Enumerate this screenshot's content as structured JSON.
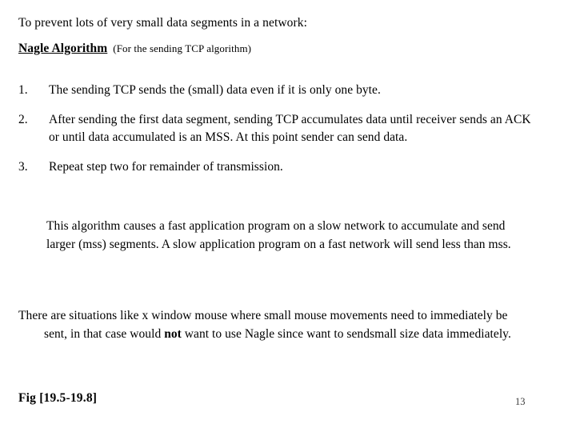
{
  "slide": {
    "intro_line": "To prevent lots of very small data segments in a network:",
    "heading": {
      "title": "Nagle Algorithm",
      "note": "(For the sending TCP algorithm)"
    },
    "steps": [
      {
        "number": "1.",
        "text": "The sending TCP sends the (small) data even if it is only one byte."
      },
      {
        "number": "2.",
        "text": "After sending the first data segment, sending TCP accumulates data until receiver sends an ACK or until data accumulated is an MSS. At this point sender can send data."
      },
      {
        "number": "3.",
        "text": "Repeat step two for remainder of transmission."
      }
    ],
    "indented_paragraph": "This algorithm causes a fast application program on a slow network to accumulate and send larger (mss) segments. A slow application program on a fast network will send less than mss.",
    "final_paragraph": {
      "part1": "There are situations like x window mouse where small mouse movements need to immediately be sent, in that case would ",
      "emphasis": "not",
      "part2": " want to use Nagle since want to sendsmall size data immediately."
    },
    "footer": {
      "figure_label": "Fig [19.5-19.8]",
      "page_number": "13"
    }
  }
}
